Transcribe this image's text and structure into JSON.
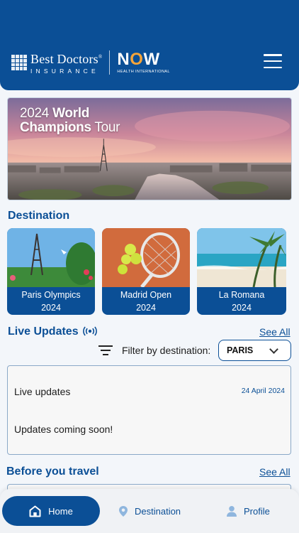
{
  "header": {
    "brand_name": "Best Doctors",
    "brand_sub": "INSURANCE",
    "brand_mark": "®",
    "partner_name": "NOW",
    "partner_sub": "HEALTH INTERNATIONAL",
    "menu_icon": "hamburger-menu-icon"
  },
  "hero": {
    "year": "2024",
    "title_strong_1": "World",
    "title_strong_2": "Champions",
    "title_light": "Tour"
  },
  "destinations": {
    "title": "Destination",
    "items": [
      {
        "name": "Paris Olympics",
        "year": "2024"
      },
      {
        "name": "Madrid Open",
        "year": "2024"
      },
      {
        "name": "La Romana",
        "year": "2024"
      }
    ]
  },
  "live_updates": {
    "title": "Live Updates",
    "see_all": "See All",
    "filter_label": "Filter by destination:",
    "selected_destination": "PARIS",
    "card": {
      "title": "Live updates",
      "date": "24 April 2024",
      "body": "Updates coming soon!"
    }
  },
  "before_travel": {
    "title": "Before you travel",
    "see_all": "See All"
  },
  "bottom_nav": {
    "items": [
      {
        "label": "Home",
        "icon": "home-icon",
        "active": true
      },
      {
        "label": "Destination",
        "icon": "location-pin-icon",
        "active": false
      },
      {
        "label": "Profile",
        "icon": "person-icon",
        "active": false
      }
    ]
  },
  "colors": {
    "primary": "#0b4f96",
    "accent_orange": "#f4a43a",
    "background": "#f3f6fa"
  }
}
